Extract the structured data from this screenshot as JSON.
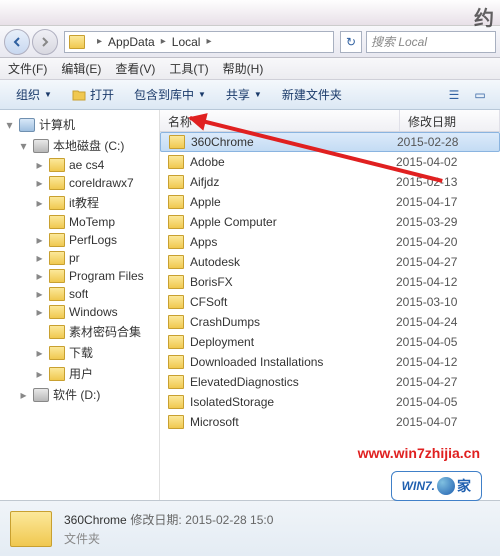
{
  "corner_watermark": "约",
  "breadcrumb": {
    "parts": [
      "AppData",
      "Local"
    ]
  },
  "search": {
    "placeholder": "搜索 Local"
  },
  "menubar": {
    "file": "文件(F)",
    "edit": "编辑(E)",
    "view": "查看(V)",
    "tools": "工具(T)",
    "help": "帮助(H)"
  },
  "toolbar": {
    "organize": "组织",
    "open": "打开",
    "include": "包含到库中",
    "share": "共享",
    "new_folder": "新建文件夹"
  },
  "tree": {
    "items": [
      {
        "label": "计算机",
        "level": 0,
        "icon": "computer",
        "exp": "▾"
      },
      {
        "label": "本地磁盘 (C:)",
        "level": 1,
        "icon": "drive",
        "exp": "▾"
      },
      {
        "label": "ae cs4",
        "level": 2,
        "icon": "folder",
        "exp": "▸"
      },
      {
        "label": "coreldrawx7",
        "level": 2,
        "icon": "folder",
        "exp": "▸"
      },
      {
        "label": "it教程",
        "level": 2,
        "icon": "folder",
        "exp": "▸"
      },
      {
        "label": "MoTemp",
        "level": 2,
        "icon": "folder",
        "exp": ""
      },
      {
        "label": "PerfLogs",
        "level": 2,
        "icon": "folder",
        "exp": "▸"
      },
      {
        "label": "pr",
        "level": 2,
        "icon": "folder",
        "exp": "▸"
      },
      {
        "label": "Program Files",
        "level": 2,
        "icon": "folder",
        "exp": "▸"
      },
      {
        "label": "soft",
        "level": 2,
        "icon": "folder",
        "exp": "▸"
      },
      {
        "label": "Windows",
        "level": 2,
        "icon": "folder",
        "exp": "▸"
      },
      {
        "label": "素材密码合集",
        "level": 2,
        "icon": "folder",
        "exp": ""
      },
      {
        "label": "下载",
        "level": 2,
        "icon": "folder",
        "exp": "▸"
      },
      {
        "label": "用户",
        "level": 2,
        "icon": "folder",
        "exp": "▸"
      },
      {
        "label": "软件 (D:)",
        "level": 1,
        "icon": "drive",
        "exp": "▸"
      }
    ]
  },
  "list": {
    "columns": {
      "name": "名称",
      "date": "修改日期"
    },
    "rows": [
      {
        "name": "360Chrome",
        "date": "2015-02-28",
        "selected": true
      },
      {
        "name": "Adobe",
        "date": "2015-04-02"
      },
      {
        "name": "Aifjdz",
        "date": "2015-02-13"
      },
      {
        "name": "Apple",
        "date": "2015-04-17"
      },
      {
        "name": "Apple Computer",
        "date": "2015-03-29"
      },
      {
        "name": "Apps",
        "date": "2015-04-20"
      },
      {
        "name": "Autodesk",
        "date": "2015-04-27"
      },
      {
        "name": "BorisFX",
        "date": "2015-04-12"
      },
      {
        "name": "CFSoft",
        "date": "2015-03-10"
      },
      {
        "name": "CrashDumps",
        "date": "2015-04-24"
      },
      {
        "name": "Deployment",
        "date": "2015-04-05"
      },
      {
        "name": "Downloaded Installations",
        "date": "2015-04-12"
      },
      {
        "name": "ElevatedDiagnostics",
        "date": "2015-04-27"
      },
      {
        "name": "IsolatedStorage",
        "date": "2015-04-05"
      },
      {
        "name": "Microsoft",
        "date": "2015-04-07"
      }
    ]
  },
  "details": {
    "name": "360Chrome",
    "type": "文件夹",
    "date_label": "修改日期:",
    "date_value": "2015-02-28 15:0"
  },
  "watermark": {
    "url": "www.win7zhijia.cn",
    "logo_main": "WIN7.",
    "logo_home": "家"
  }
}
